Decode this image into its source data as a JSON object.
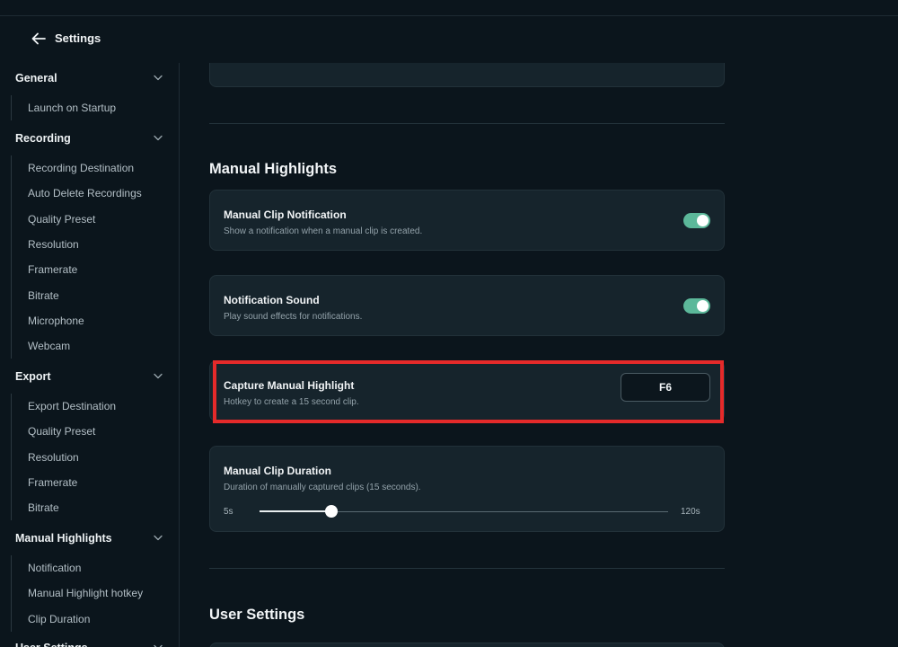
{
  "header": {
    "title": "Settings"
  },
  "sidebar": {
    "sections": [
      {
        "title": "General",
        "items": [
          "Launch on Startup"
        ]
      },
      {
        "title": "Recording",
        "items": [
          "Recording Destination",
          "Auto Delete Recordings",
          "Quality Preset",
          "Resolution",
          "Framerate",
          "Bitrate",
          "Microphone",
          "Webcam"
        ]
      },
      {
        "title": "Export",
        "items": [
          "Export Destination",
          "Quality Preset",
          "Resolution",
          "Framerate",
          "Bitrate"
        ]
      },
      {
        "title": "Manual Highlights",
        "items": [
          "Notification",
          "Manual Highlight hotkey",
          "Clip Duration"
        ]
      },
      {
        "title": "User Settings",
        "items": []
      }
    ]
  },
  "main": {
    "manual_highlights": {
      "heading": "Manual Highlights",
      "notification": {
        "title": "Manual Clip Notification",
        "desc": "Show a notification when a manual clip is created.",
        "enabled": true
      },
      "sound": {
        "title": "Notification Sound",
        "desc": "Play sound effects for notifications.",
        "enabled": true
      },
      "capture": {
        "title": "Capture Manual Highlight",
        "desc": "Hotkey to create a 15 second clip.",
        "hotkey": "F6"
      },
      "duration": {
        "title": "Manual Clip Duration",
        "desc": "Duration of manually captured clips (15 seconds).",
        "min_label": "5s",
        "max_label": "120s",
        "min": 5,
        "max": 120,
        "value": 15
      }
    },
    "user_settings": {
      "heading": "User Settings"
    }
  },
  "colors": {
    "background": "#0b151c",
    "card": "#16242c",
    "accent": "#5cb89a",
    "highlight": "#e52a2a"
  }
}
